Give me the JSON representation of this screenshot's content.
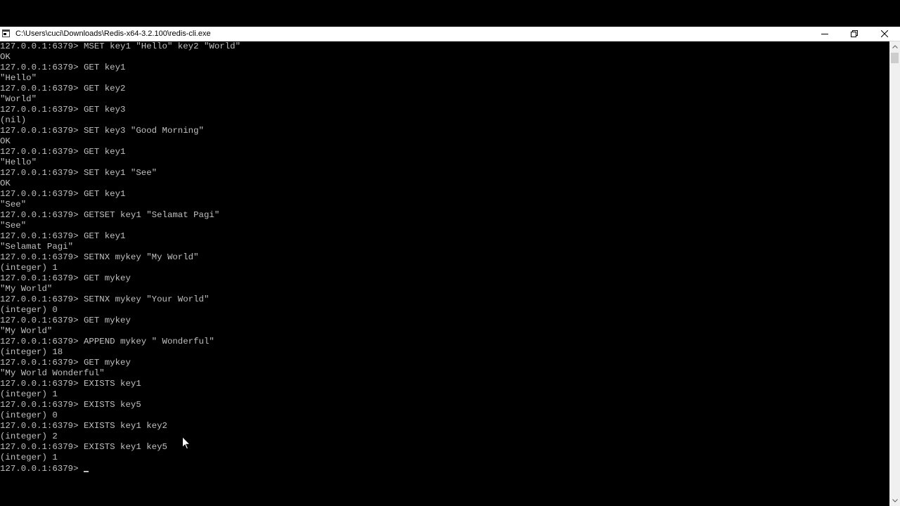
{
  "window": {
    "title": "C:\\Users\\cuci\\Downloads\\Redis-x64-3.2.100\\redis-cli.exe",
    "icons": {
      "app": "console-app-icon",
      "minimize": "minimize-icon",
      "maximize": "restore-icon",
      "close": "close-icon"
    }
  },
  "console": {
    "lines": [
      "127.0.0.1:6379> MSET key1 \"Hello\" key2 \"World\"",
      "OK",
      "127.0.0.1:6379> GET key1",
      "\"Hello\"",
      "127.0.0.1:6379> GET key2",
      "\"World\"",
      "127.0.0.1:6379> GET key3",
      "(nil)",
      "127.0.0.1:6379> SET key3 \"Good Morning\"",
      "OK",
      "127.0.0.1:6379> GET key1",
      "\"Hello\"",
      "127.0.0.1:6379> SET key1 \"See\"",
      "OK",
      "127.0.0.1:6379> GET key1",
      "\"See\"",
      "127.0.0.1:6379> GETSET key1 \"Selamat Pagi\"",
      "\"See\"",
      "127.0.0.1:6379> GET key1",
      "\"Selamat Pagi\"",
      "127.0.0.1:6379> SETNX mykey \"My World\"",
      "(integer) 1",
      "127.0.0.1:6379> GET mykey",
      "\"My World\"",
      "127.0.0.1:6379> SETNX mykey \"Your World\"",
      "(integer) 0",
      "127.0.0.1:6379> GET mykey",
      "\"My World\"",
      "127.0.0.1:6379> APPEND mykey \" Wonderful\"",
      "(integer) 18",
      "127.0.0.1:6379> GET mykey",
      "\"My World Wonderful\"",
      "127.0.0.1:6379> EXISTS key1",
      "(integer) 1",
      "127.0.0.1:6379> EXISTS key5",
      "(integer) 0",
      "127.0.0.1:6379> EXISTS key1 key2",
      "(integer) 2",
      "127.0.0.1:6379> EXISTS key1 key5",
      "(integer) 1"
    ],
    "prompt": "127.0.0.1:6379> ",
    "text_color": "#c0c0c0",
    "background": "#000000"
  },
  "scrollbar": {
    "icons": {
      "up": "scroll-up-arrow-icon",
      "down": "scroll-down-arrow-icon"
    }
  }
}
